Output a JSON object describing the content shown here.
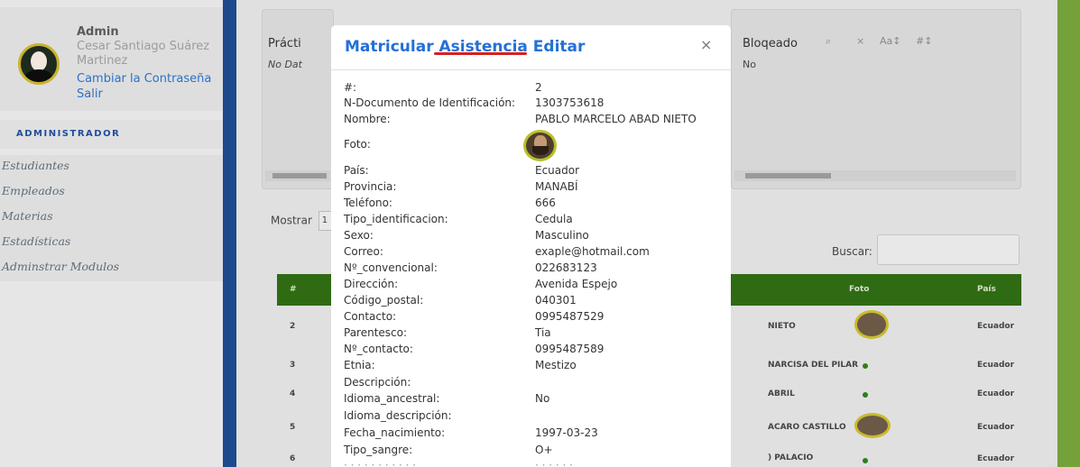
{
  "sidebar": {
    "user_title": "Admin",
    "user_fullname": "Cesar Santiago Suárez Martinez",
    "change_password": "Cambiar la Contraseña",
    "logout": "Salir",
    "role": "ADMINISTRADOR",
    "menu": [
      "Estudiantes",
      "Empleados",
      "Materias",
      "Estadísticas",
      "Adminstrar Modulos"
    ]
  },
  "background": {
    "col_practicas": "Prácti",
    "no_data": "No Dat",
    "col_bloqueado": "Bloqeado",
    "bloqueado_value": "No",
    "controls": [
      "⌕",
      "×",
      "Aa↕",
      "#↕"
    ],
    "mostrar": "Mostrar",
    "mostrar_value": "1",
    "buscar": "Buscar:",
    "table_header": {
      "num": "#",
      "foto": "Foto",
      "pais": "País"
    },
    "rows": [
      {
        "num": "2",
        "name": "NIETO",
        "pais": "Ecuador",
        "foto": "photo"
      },
      {
        "num": "3",
        "name": "NARCISA DEL PILAR",
        "pais": "Ecuador",
        "foto": "dot"
      },
      {
        "num": "4",
        "name": "ABRIL",
        "pais": "Ecuador",
        "foto": "dot"
      },
      {
        "num": "5",
        "name": "ACARO CASTILLO",
        "pais": "Ecuador",
        "foto": "photo"
      },
      {
        "num": "6",
        "name": ") PALACIO",
        "pais": "Ecuador",
        "foto": "dot"
      }
    ]
  },
  "modal": {
    "title": "Matricular Asistencia Editar",
    "close": "×",
    "fields": [
      {
        "label": "#:",
        "value": "2"
      },
      {
        "label": "N-Documento de Identificación:",
        "value": "1303753618"
      },
      {
        "label": "Nombre:",
        "value": "PABLO MARCELO ABAD NIETO"
      },
      {
        "label": "Foto:",
        "value": ""
      },
      {
        "label": "País:",
        "value": "Ecuador"
      },
      {
        "label": "Provincia:",
        "value": "MANABÍ"
      },
      {
        "label": "Teléfono:",
        "value": "666"
      },
      {
        "label": "Tipo_identificacion:",
        "value": "Cedula"
      },
      {
        "label": "Sexo:",
        "value": "Masculino"
      },
      {
        "label": "Correo:",
        "value": "exaple@hotmail.com"
      },
      {
        "label": "Nº_convencional:",
        "value": "022683123"
      },
      {
        "label": "Dirección:",
        "value": "Avenida Espejo"
      },
      {
        "label": "Código_postal:",
        "value": "040301"
      },
      {
        "label": "Contacto:",
        "value": "0995487529"
      },
      {
        "label": "Parentesco:",
        "value": "Tia"
      },
      {
        "label": "Nº_contacto:",
        "value": "0995487589"
      },
      {
        "label": "Etnia:",
        "value": "Mestizo"
      },
      {
        "label": "Descripción:",
        "value": ""
      },
      {
        "label": "Idioma_ancestral:",
        "value": "No"
      },
      {
        "label": "Idioma_descripción:",
        "value": ""
      },
      {
        "label": "Fecha_nacimiento:",
        "value": "1997-03-23"
      },
      {
        "label": "Tipo_sangre:",
        "value": "O+"
      }
    ]
  },
  "colors": {
    "sidebar_bar": "#1c4a8c",
    "table_header": "#2f6b13",
    "modal_title": "#2470d6",
    "underline": "#d62020",
    "right_strip": "#74a139"
  }
}
